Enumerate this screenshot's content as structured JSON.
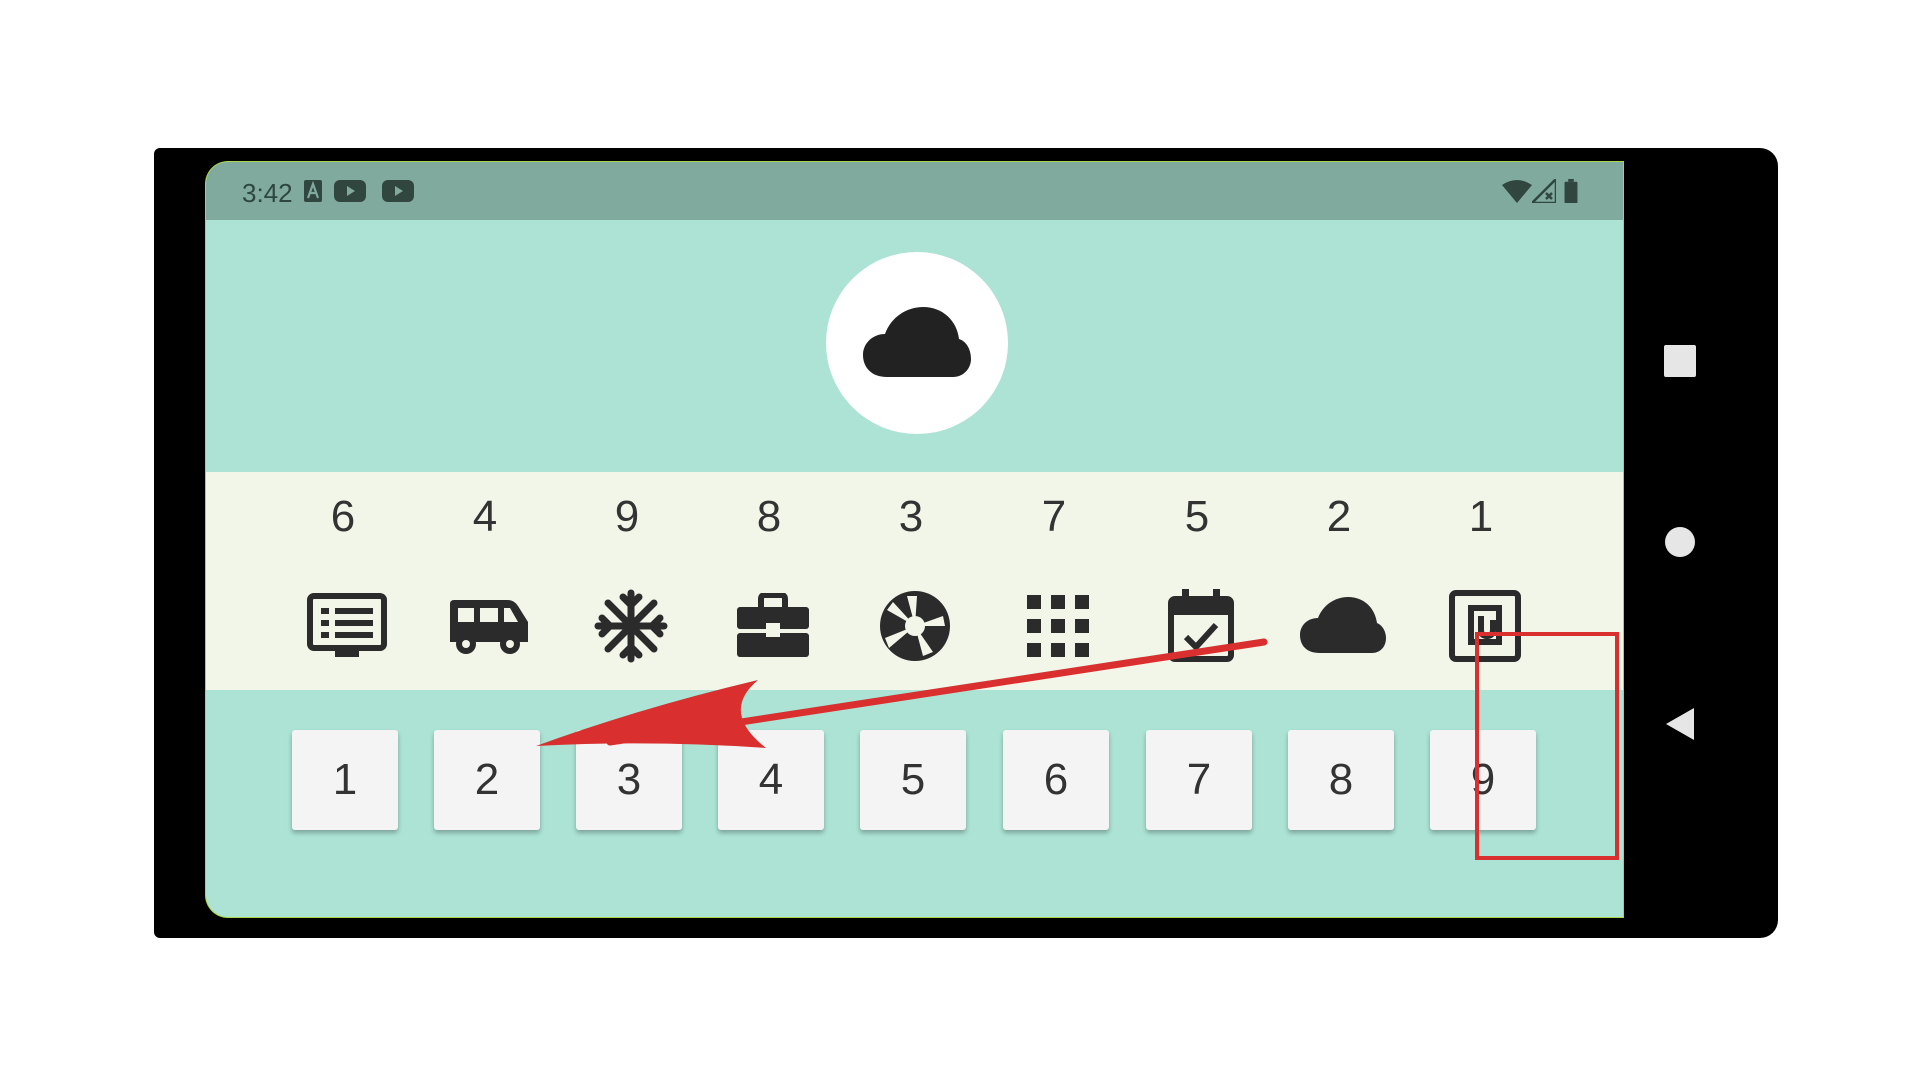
{
  "status_bar": {
    "time": "3:42",
    "left_icons": [
      "a-notification-icon",
      "youtube-icon",
      "youtube-icon"
    ],
    "right_icons": [
      "wifi-icon",
      "signal-icon",
      "battery-icon"
    ]
  },
  "target": {
    "icon": "cloud-icon"
  },
  "icon_row": {
    "numbers": [
      "6",
      "4",
      "9",
      "8",
      "3",
      "7",
      "5",
      "2",
      "1"
    ],
    "icons": [
      "tv-guide-icon",
      "van-icon",
      "snowflake-icon",
      "toolbox-icon",
      "aperture-icon",
      "grid-icon",
      "calendar-check-icon",
      "cloud-icon",
      "nfc-icon"
    ]
  },
  "keypad": {
    "keys": [
      "1",
      "2",
      "3",
      "4",
      "5",
      "6",
      "7",
      "8",
      "9"
    ]
  },
  "nav": [
    "recents-button",
    "home-button",
    "back-button"
  ],
  "annotation": {
    "color": "#d9302f"
  },
  "colors": {
    "screen_bg": "#ace3d5",
    "status_bar": "#80aa9d",
    "strip_bg": "#f1f6e8",
    "key_bg": "#f4f4f4"
  }
}
